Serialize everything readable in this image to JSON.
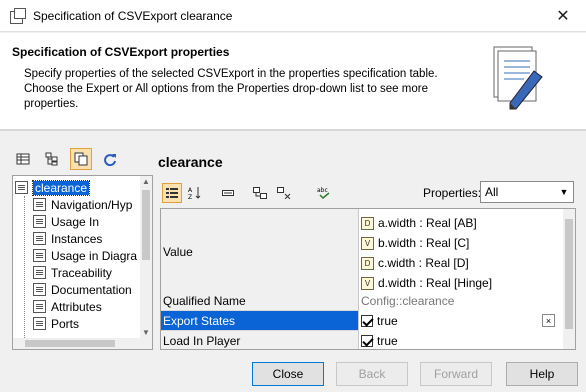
{
  "window": {
    "title": "Specification of CSVExport clearance",
    "close_glyph": "✕"
  },
  "header": {
    "title": "Specification of CSVExport properties",
    "description": "Specify properties of the selected CSVExport in the properties specification table. Choose the Expert or All options from the Properties drop-down list to see more properties."
  },
  "left_toolbar": {
    "icons": [
      "table-view-icon",
      "tree-view-icon",
      "copy-icon",
      "refresh-icon"
    ]
  },
  "tree": {
    "root": "clearance",
    "items": [
      "Navigation/Hyp",
      "Usage In",
      "Instances",
      "Usage in Diagra",
      "Traceability",
      "Documentation",
      "Attributes",
      "Ports"
    ]
  },
  "section_title": "clearance",
  "right_toolbar": {
    "properties_label": "Properties:",
    "properties_value": "All",
    "icons": [
      "categorized-icon",
      "sort-alpha-icon",
      "compact-icon",
      "expand-icon",
      "collapse-icon",
      "spell-check-icon"
    ]
  },
  "grid": {
    "value_label": "Value",
    "values": [
      {
        "tag": "D",
        "text": "a.width : Real [AB]"
      },
      {
        "tag": "V",
        "text": "b.width : Real [C]"
      },
      {
        "tag": "D",
        "text": "c.width : Real [D]"
      },
      {
        "tag": "V",
        "text": "d.width : Real [Hinge]"
      }
    ],
    "qualified_name_label": "Qualified Name",
    "qualified_name_value": "Config::clearance",
    "export_states_label": "Export States",
    "export_states_value": "true",
    "load_in_player_label": "Load In Player",
    "load_in_player_value": "true",
    "clear_glyph": "×"
  },
  "buttons": {
    "close": "Close",
    "back": "Back",
    "forward": "Forward",
    "help": "Help"
  },
  "colors": {
    "selection": "#0a64d6",
    "active_toggle": "#fbe0b0"
  }
}
